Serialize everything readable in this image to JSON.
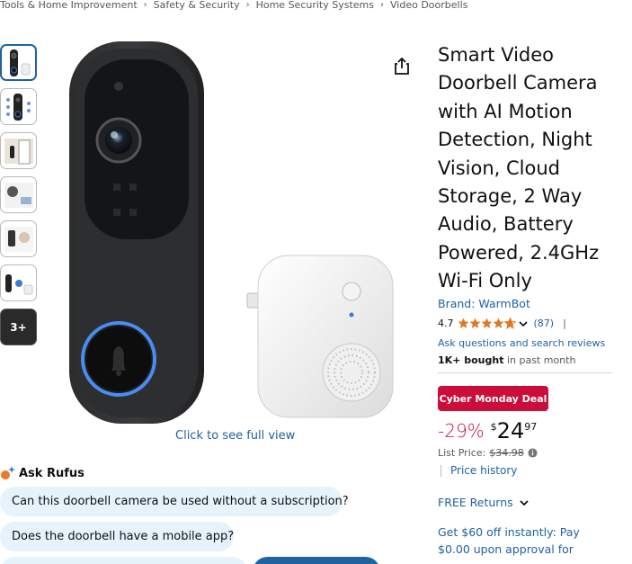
{
  "breadcrumb": [
    "Tools & Home Improvement",
    "Safety & Security",
    "Home Security Systems",
    "Video Doorbells"
  ],
  "gallery": {
    "more_label": "3+",
    "full_view_label": "Click to see full view"
  },
  "rufus": {
    "title": "Ask Rufus",
    "questions": [
      "Can this doorbell camera be used without a subscription?",
      "Does the doorbell have a mobile app?"
    ]
  },
  "product": {
    "title": "Smart Video Doorbell Camera with AI Motion Detection, Night Vision, Cloud Storage, 2 Way Audio, Battery Powered, 2.4GHz Wi-Fi Only",
    "brand": "Brand: WarmBot",
    "rating": "4.7",
    "review_count": "(87)",
    "rating_divider": "|",
    "ask_link": "Ask questions and search reviews",
    "bought_bold": "1K+ bought",
    "bought_rest": " in past month",
    "deal_badge": "Cyber Monday Deal",
    "discount": "-29%",
    "currency": "$",
    "price_whole": "24",
    "price_fraction": "97",
    "list_price_label": "List Price:",
    "list_price_value": "$34.98",
    "price_history": "Price history",
    "free_returns": "FREE Returns",
    "offer": "Get $60 off instantly: Pay $0.00 upon approval for"
  },
  "colors": {
    "link": "#2162a1",
    "deal": "#cc0c39",
    "chip": "#e6f3fb",
    "star": "#de7921"
  }
}
